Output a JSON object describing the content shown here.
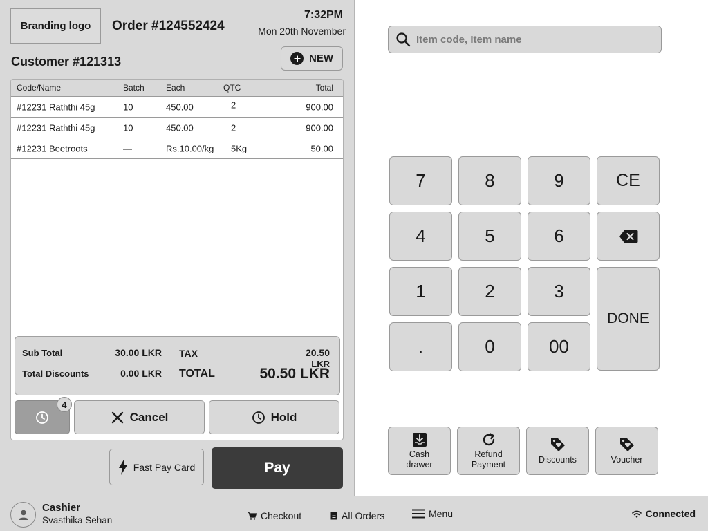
{
  "header": {
    "brand_logo": "Branding logo",
    "order_number": "Order #124552424",
    "time": "7:32PM",
    "date": "Mon 20th November",
    "customer": "Customer #121313",
    "new_label": "NEW"
  },
  "cart": {
    "columns": {
      "code_name": "Code/Name",
      "batch": "Batch",
      "each": "Each",
      "qtc": "QTC",
      "total": "Total"
    },
    "rows": [
      {
        "code_name": "#12231  Raththi 45g",
        "batch": "10",
        "each": "450.00",
        "qtc": "2",
        "total": "900.00"
      },
      {
        "code_name": "#12231  Raththi 45g",
        "batch": "10",
        "each": "450.00",
        "qtc": "2",
        "total": "900.00"
      },
      {
        "code_name": "#12231  Beetroots",
        "batch": "—",
        "each": "Rs.10.00/kg",
        "qtc": "5Kg",
        "total": "50.00"
      }
    ]
  },
  "totals": {
    "sub_total_label": "Sub Total",
    "sub_total_value": "30.00 LKR",
    "discounts_label": "Total Discounts",
    "discounts_value": "0.00 LKR",
    "tax_label": "TAX",
    "tax_value": "20.50",
    "tax_unit": "LKR",
    "total_label": "TOTAL",
    "total_value": "50.50 LKR"
  },
  "actions": {
    "history_count": "4",
    "cancel_label": "Cancel",
    "hold_label": "Hold",
    "fast_pay_label": "Fast Pay Card",
    "pay_label": "Pay"
  },
  "search": {
    "placeholder": "Item code, Item name"
  },
  "keypad": {
    "k7": "7",
    "k8": "8",
    "k9": "9",
    "ce": "CE",
    "k4": "4",
    "k5": "5",
    "k6": "6",
    "k1": "1",
    "k2": "2",
    "k3": "3",
    "done": "DONE",
    "dot": ".",
    "k0": "0",
    "k00": "00"
  },
  "functions": {
    "cash_drawer": "Cash drawer",
    "refund_payment": "Refund Payment",
    "discounts": "Discounts",
    "voucher": "Voucher"
  },
  "footer": {
    "role": "Cashier",
    "name": "Svasthika Sehan",
    "checkout": "Checkout",
    "all_orders": "All Orders",
    "menu": "Menu",
    "status": "Connected"
  },
  "icons": {
    "new": "plus-circle-icon",
    "history": "clock-icon",
    "cancel": "close-icon",
    "hold": "clock-icon",
    "fast_pay": "lightning-icon",
    "search": "search-icon",
    "backspace": "backspace-icon",
    "cash_drawer": "download-tray-icon",
    "refund": "refresh-icon",
    "discounts": "tag-heart-icon",
    "voucher": "tag-heart-icon",
    "avatar": "user-icon",
    "checkout": "cart-icon",
    "all_orders": "document-icon",
    "menu": "hamburger-icon",
    "connection": "wifi-icon"
  },
  "colors": {
    "panel_bg": "#d9d9d9",
    "pay_button": "#3b3b3b",
    "history_button": "#9e9e9e",
    "border": "#9a9a9a"
  }
}
